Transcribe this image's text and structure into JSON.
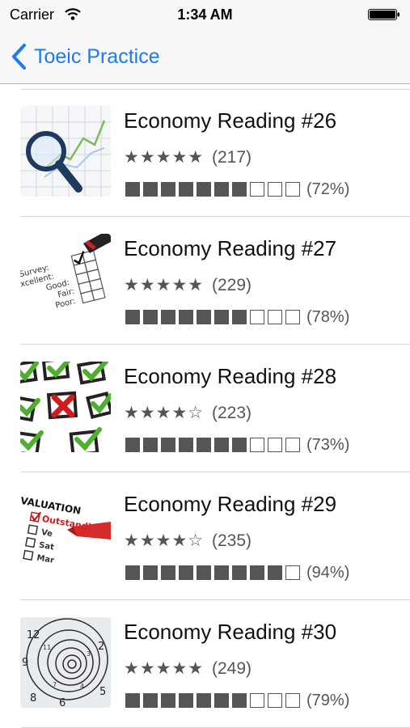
{
  "status": {
    "carrier": "Carrier",
    "time": "1:34 AM"
  },
  "nav": {
    "back_label": "Toeic Practice"
  },
  "colors": {
    "accent": "#1a7bf5",
    "progress_fill": "#555555"
  },
  "items": [
    {
      "title": "Economy Reading #26",
      "stars": "★★★★★",
      "rating_count": "(217)",
      "progress": 0.72,
      "progress_label": "(72%)",
      "thumbnail_icon": "magnifier-chart-icon"
    },
    {
      "title": "Economy Reading #27",
      "stars": "★★★★★",
      "rating_count": "(229)",
      "progress": 0.78,
      "progress_label": "(78%)",
      "thumbnail_icon": "survey-form-icon"
    },
    {
      "title": "Economy Reading #28",
      "stars": "★★★★☆",
      "rating_count": "(223)",
      "progress": 0.73,
      "progress_label": "(73%)",
      "thumbnail_icon": "checkbox-cross-icon"
    },
    {
      "title": "Economy Reading #29",
      "stars": "★★★★☆",
      "rating_count": "(235)",
      "progress": 0.94,
      "progress_label": "(94%)",
      "thumbnail_icon": "evaluation-form-icon"
    },
    {
      "title": "Economy Reading #30",
      "stars": "★★★★★",
      "rating_count": "(249)",
      "progress": 0.79,
      "progress_label": "(79%)",
      "thumbnail_icon": "spiral-clock-icon"
    }
  ]
}
